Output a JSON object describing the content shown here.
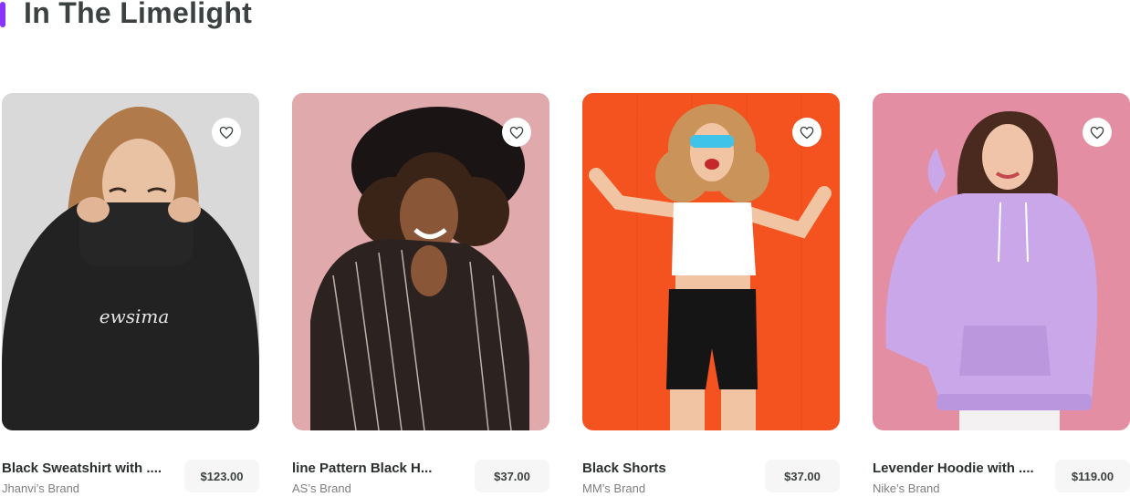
{
  "section": {
    "title": "In The Limelight",
    "accent_color": "#8a33fd"
  },
  "products": [
    {
      "name": "Black Sweatshirt with ....",
      "brand": "Jhanvi’s  Brand",
      "price": "$123.00",
      "image_bg": "#d9d9d9",
      "wishlist_icon": "heart-outline-icon"
    },
    {
      "name": "line Pattern Black H...",
      "brand": "AS’s  Brand",
      "price": "$37.00",
      "image_bg": "#e0a9ab",
      "wishlist_icon": "heart-outline-icon"
    },
    {
      "name": "Black Shorts",
      "brand": "MM’s  Brand",
      "price": "$37.00",
      "image_bg": "#f4531f",
      "wishlist_icon": "heart-outline-icon"
    },
    {
      "name": "Levender Hoodie with ....",
      "brand": "Nike’s  Brand",
      "price": "$119.00",
      "image_bg": "#e48ea3",
      "wishlist_icon": "heart-outline-icon"
    }
  ]
}
